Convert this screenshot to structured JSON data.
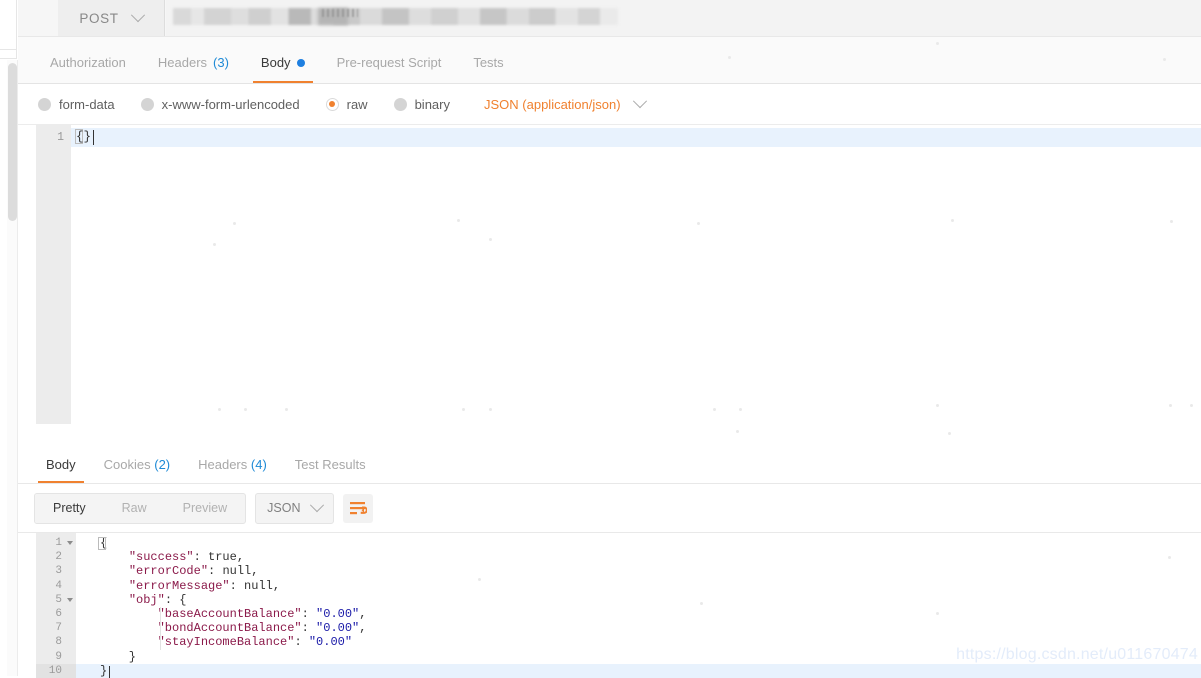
{
  "request": {
    "method": "POST",
    "url_redacted": "",
    "tabs": [
      {
        "label": "Authorization",
        "count": "",
        "active": false,
        "dot": false
      },
      {
        "label": "Headers",
        "count": "(3)",
        "active": false,
        "dot": false
      },
      {
        "label": "Body",
        "count": "",
        "active": true,
        "dot": true
      },
      {
        "label": "Pre-request Script",
        "count": "",
        "active": false,
        "dot": false
      },
      {
        "label": "Tests",
        "count": "",
        "active": false,
        "dot": false
      }
    ],
    "body_types": [
      {
        "label": "form-data",
        "checked": false
      },
      {
        "label": "x-www-form-urlencoded",
        "checked": false
      },
      {
        "label": "raw",
        "checked": true
      },
      {
        "label": "binary",
        "checked": false
      }
    ],
    "content_type": "JSON (application/json)",
    "editor": {
      "line_numbers": [
        "1"
      ],
      "content": "{}"
    }
  },
  "response": {
    "tabs": [
      {
        "label": "Body",
        "count": "",
        "active": true
      },
      {
        "label": "Cookies",
        "count": "(2)",
        "active": false
      },
      {
        "label": "Headers",
        "count": "(4)",
        "active": false
      },
      {
        "label": "Test Results",
        "count": "",
        "active": false
      }
    ],
    "format_buttons": [
      {
        "label": "Pretty",
        "active": true
      },
      {
        "label": "Raw",
        "active": false
      },
      {
        "label": "Preview",
        "active": false
      }
    ],
    "language": "JSON",
    "wrap_icon": "word-wrap-icon",
    "line_numbers": [
      "1",
      "2",
      "3",
      "4",
      "5",
      "6",
      "7",
      "8",
      "9",
      "10"
    ],
    "fold_lines": [
      1,
      5
    ],
    "highlighted_line": 10,
    "json_lines": [
      [
        {
          "t": "{",
          "c": "jpunc"
        }
      ],
      [
        {
          "t": "    ",
          "c": "jpunc"
        },
        {
          "t": "\"success\"",
          "c": "jkey"
        },
        {
          "t": ": ",
          "c": "jpunc"
        },
        {
          "t": "true",
          "c": "jlit"
        },
        {
          "t": ",",
          "c": "jpunc"
        }
      ],
      [
        {
          "t": "    ",
          "c": "jpunc"
        },
        {
          "t": "\"errorCode\"",
          "c": "jkey"
        },
        {
          "t": ": ",
          "c": "jpunc"
        },
        {
          "t": "null",
          "c": "jlit"
        },
        {
          "t": ",",
          "c": "jpunc"
        }
      ],
      [
        {
          "t": "    ",
          "c": "jpunc"
        },
        {
          "t": "\"errorMessage\"",
          "c": "jkey"
        },
        {
          "t": ": ",
          "c": "jpunc"
        },
        {
          "t": "null",
          "c": "jlit"
        },
        {
          "t": ",",
          "c": "jpunc"
        }
      ],
      [
        {
          "t": "    ",
          "c": "jpunc"
        },
        {
          "t": "\"obj\"",
          "c": "jkey"
        },
        {
          "t": ": {",
          "c": "jpunc"
        }
      ],
      [
        {
          "t": "        ",
          "c": "jpunc"
        },
        {
          "t": "\"baseAccountBalance\"",
          "c": "jkey"
        },
        {
          "t": ": ",
          "c": "jpunc"
        },
        {
          "t": "\"0.00\"",
          "c": "jstr"
        },
        {
          "t": ",",
          "c": "jpunc"
        }
      ],
      [
        {
          "t": "        ",
          "c": "jpunc"
        },
        {
          "t": "\"bondAccountBalance\"",
          "c": "jkey"
        },
        {
          "t": ": ",
          "c": "jpunc"
        },
        {
          "t": "\"0.00\"",
          "c": "jstr"
        },
        {
          "t": ",",
          "c": "jpunc"
        }
      ],
      [
        {
          "t": "        ",
          "c": "jpunc"
        },
        {
          "t": "\"stayIncomeBalance\"",
          "c": "jkey"
        },
        {
          "t": ": ",
          "c": "jpunc"
        },
        {
          "t": "\"0.00\"",
          "c": "jstr"
        }
      ],
      [
        {
          "t": "    }",
          "c": "jpunc"
        }
      ],
      [
        {
          "t": "}",
          "c": "jpunc"
        }
      ]
    ]
  },
  "sidebar_edge": {
    "clear_all_partial": "all"
  },
  "watermark": "https://blog.csdn.net/u011670474",
  "colors": {
    "accent_orange": "#f0812f",
    "link_blue": "#1e8ad6",
    "dot_blue": "#1e7fe0",
    "json_key": "#8b1a4a",
    "json_string": "#1a1aa8",
    "gutter_gray": "#ececec",
    "active_line_blue": "#e8f2fd"
  }
}
